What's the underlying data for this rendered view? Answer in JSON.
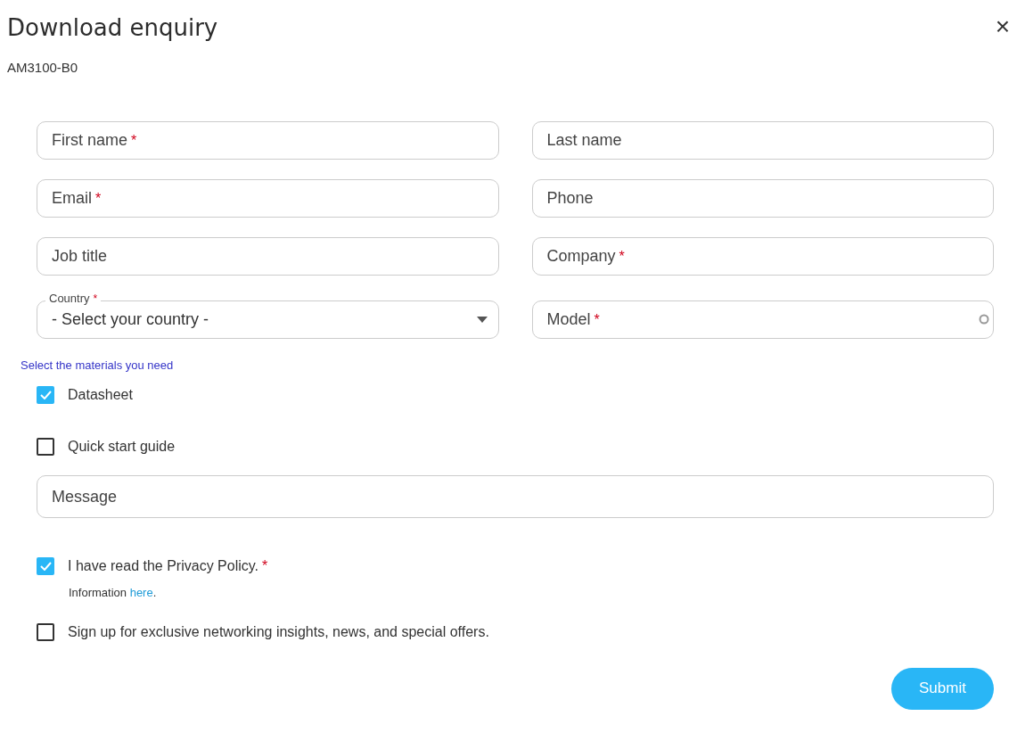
{
  "dialog": {
    "title": "Download enquiry",
    "close_icon": "×",
    "subtitle": "AM3100-B0"
  },
  "fields": [
    {
      "kind": "text",
      "label": "First name",
      "mark": "*"
    },
    {
      "kind": "text",
      "label": "Last name"
    },
    {
      "kind": "text",
      "label": "Email",
      "mark": "*"
    },
    {
      "kind": "text",
      "label": "Phone"
    },
    {
      "kind": "text",
      "label": "Job title"
    },
    {
      "kind": "text",
      "label": "Company",
      "mark": "*"
    },
    {
      "kind": "select",
      "label": "Country",
      "mark": "*",
      "value": "- Select your country -"
    },
    {
      "kind": "loading",
      "label": "Model",
      "mark": "*"
    }
  ],
  "materials": {
    "heading": "Select the materials you need",
    "options": [
      {
        "label": "Datasheet",
        "checked": true
      },
      {
        "label": "Quick start guide",
        "checked": false
      }
    ]
  },
  "message": {
    "label": "Message"
  },
  "consents": [
    {
      "label": "I have read the Privacy Policy.",
      "mark": "*",
      "checked": true,
      "note": {
        "text": "Information",
        "link": "here",
        "after": "."
      }
    },
    {
      "label": "Sign up for exclusive networking insights, news, and special offers.",
      "checked": false
    }
  ],
  "submit": "Submit"
}
